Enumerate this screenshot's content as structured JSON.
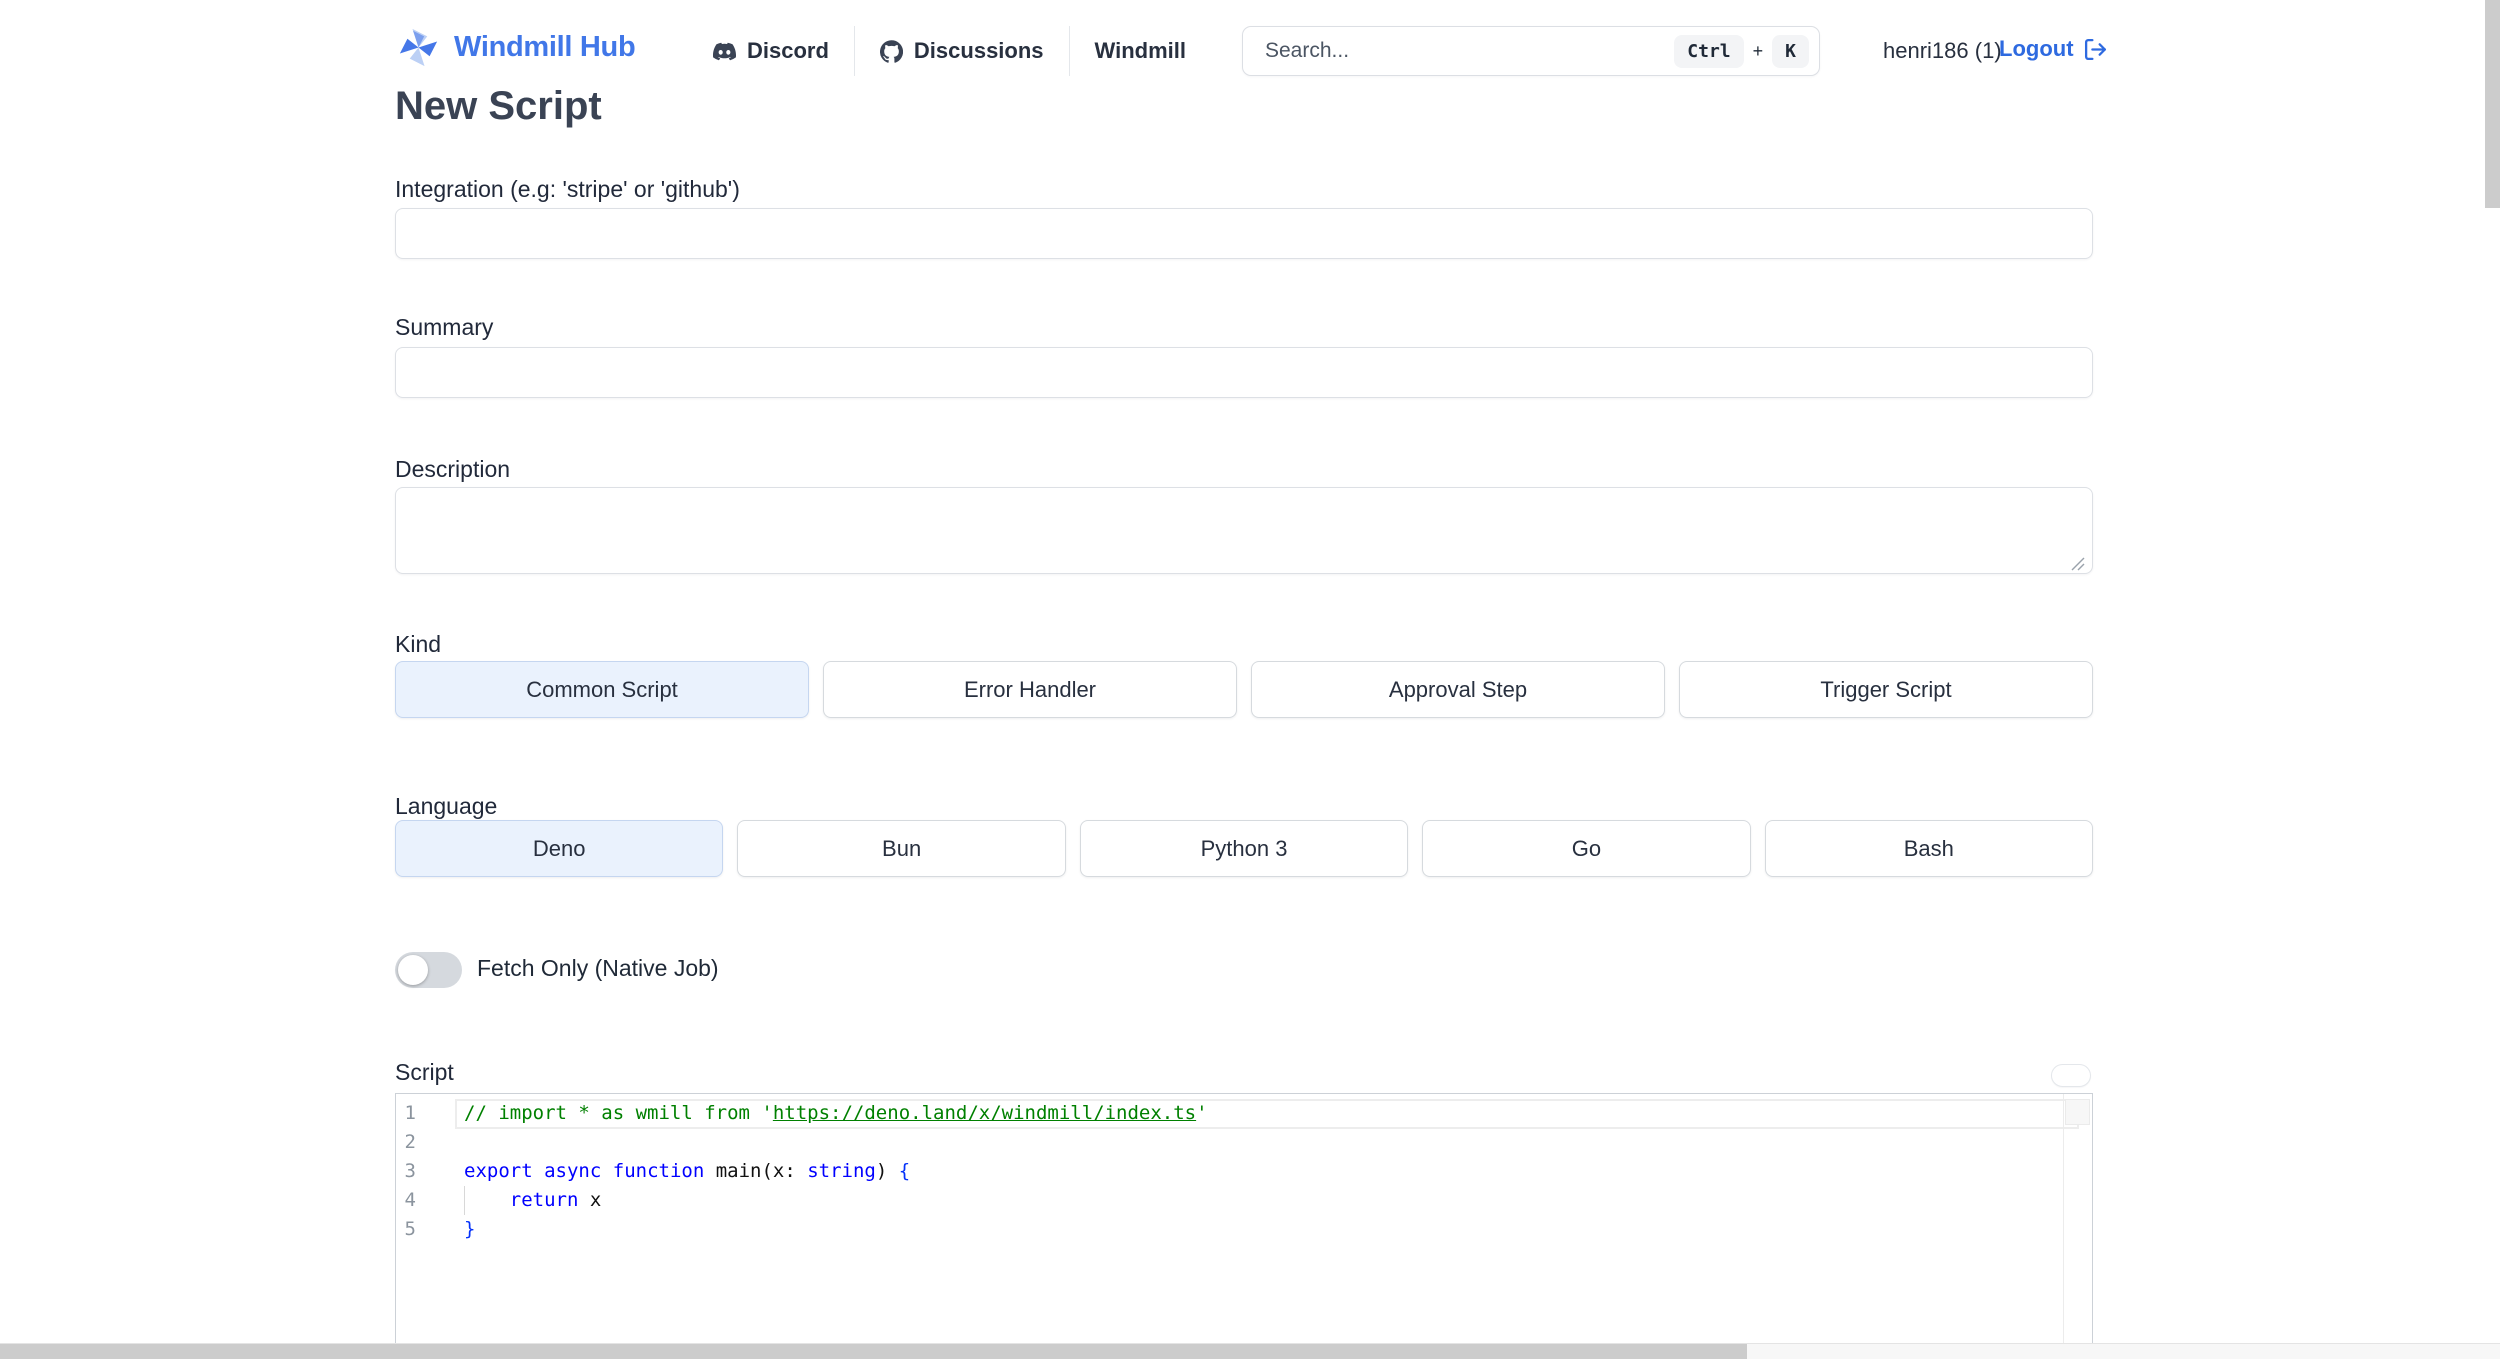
{
  "nav": {
    "brand": "Windmill Hub",
    "links": [
      {
        "label": "Discord",
        "icon": "discord-icon"
      },
      {
        "label": "Discussions",
        "icon": "github-icon"
      },
      {
        "label": "Windmill",
        "icon": null
      }
    ],
    "search": {
      "placeholder": "Search...",
      "value": "",
      "shortcut": [
        "Ctrl",
        "+",
        "K"
      ]
    },
    "user": {
      "name": "henri186 (1)",
      "logout_label": "Logout"
    }
  },
  "page": {
    "title": "New Script"
  },
  "form": {
    "integration": {
      "label": "Integration (e.g: 'stripe' or 'github')",
      "value": ""
    },
    "summary": {
      "label": "Summary",
      "value": ""
    },
    "description": {
      "label": "Description",
      "value": ""
    },
    "kind": {
      "label": "Kind",
      "options": [
        "Common Script",
        "Error Handler",
        "Approval Step",
        "Trigger Script"
      ],
      "selected": "Common Script"
    },
    "language": {
      "label": "Language",
      "options": [
        "Deno",
        "Bun",
        "Python 3",
        "Go",
        "Bash"
      ],
      "selected": "Deno"
    },
    "fetch_only": {
      "label": "Fetch Only (Native Job)",
      "enabled": false
    },
    "script": {
      "label": "Script"
    }
  },
  "editor": {
    "lines": [
      {
        "number": 1,
        "current": true,
        "tokens": [
          {
            "type": "comment",
            "text": "// import * as wmill from '"
          },
          {
            "type": "comment-link",
            "text": "https://deno.land/x/windmill/index.ts"
          },
          {
            "type": "comment",
            "text": "'"
          }
        ]
      },
      {
        "number": 2,
        "tokens": []
      },
      {
        "number": 3,
        "tokens": [
          {
            "type": "keyword",
            "text": "export"
          },
          {
            "type": "plain",
            "text": " "
          },
          {
            "type": "keyword",
            "text": "async"
          },
          {
            "type": "plain",
            "text": " "
          },
          {
            "type": "keyword",
            "text": "function"
          },
          {
            "type": "plain",
            "text": " main(x: "
          },
          {
            "type": "keyword",
            "text": "string"
          },
          {
            "type": "plain",
            "text": ") "
          },
          {
            "type": "bracket",
            "text": "{"
          }
        ]
      },
      {
        "number": 4,
        "indent_guide": true,
        "tokens": [
          {
            "type": "plain",
            "text": "    "
          },
          {
            "type": "keyword",
            "text": "return"
          },
          {
            "type": "plain",
            "text": " x"
          }
        ]
      },
      {
        "number": 5,
        "tokens": [
          {
            "type": "bracket",
            "text": "}"
          }
        ]
      }
    ]
  },
  "colors": {
    "brand_blue": "#4177e8",
    "accent_blue": "#2e6ae0",
    "selected_bg": "#eaf2fd",
    "keyword_blue": "#0000ff",
    "comment_green": "#008000",
    "bracket_blue": "#0431fa"
  }
}
